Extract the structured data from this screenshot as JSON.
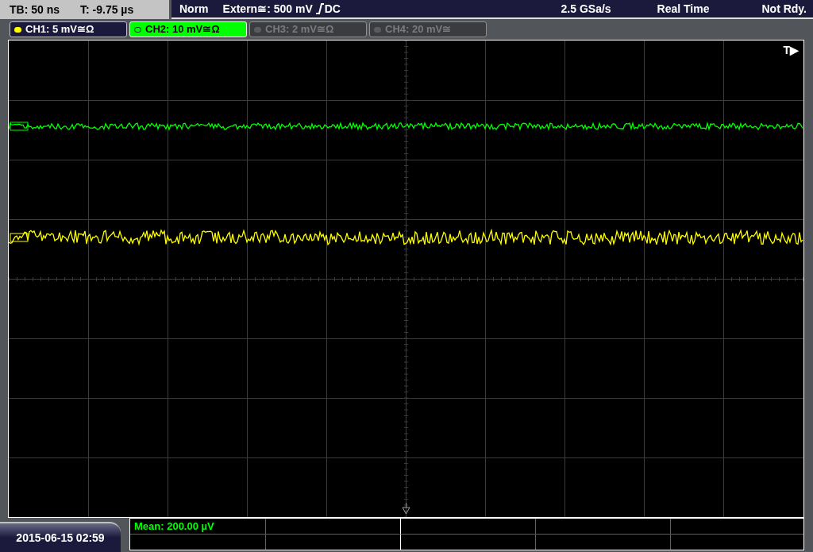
{
  "status_bar": {
    "timebase": "TB: 50 ns",
    "trigger_time": "T: -9.75 µs",
    "trigger_mode": "Norm",
    "trigger_source": "Extern≅: 500 mV",
    "trigger_coupling": "DC",
    "sample_rate": "2.5 GSa/s",
    "acquisition_mode": "Real Time",
    "trigger_state": "Not Rdy."
  },
  "channels": [
    {
      "label": "CH1: 5 mV≅Ω",
      "selected": false,
      "active": true,
      "color": "#ffff00"
    },
    {
      "label": "CH2: 10 mV≅Ω",
      "selected": true,
      "active": true,
      "color": "#00ff00"
    },
    {
      "label": "CH3: 2 mV≅Ω",
      "selected": false,
      "active": false
    },
    {
      "label": "CH4: 20 mV≅",
      "selected": false,
      "active": false
    }
  ],
  "display": {
    "trigger_position": "T▶"
  },
  "measurements": [
    {
      "label": "Mean: 200.00 µV"
    }
  ],
  "date_time": "2015-06-15 02:59"
}
